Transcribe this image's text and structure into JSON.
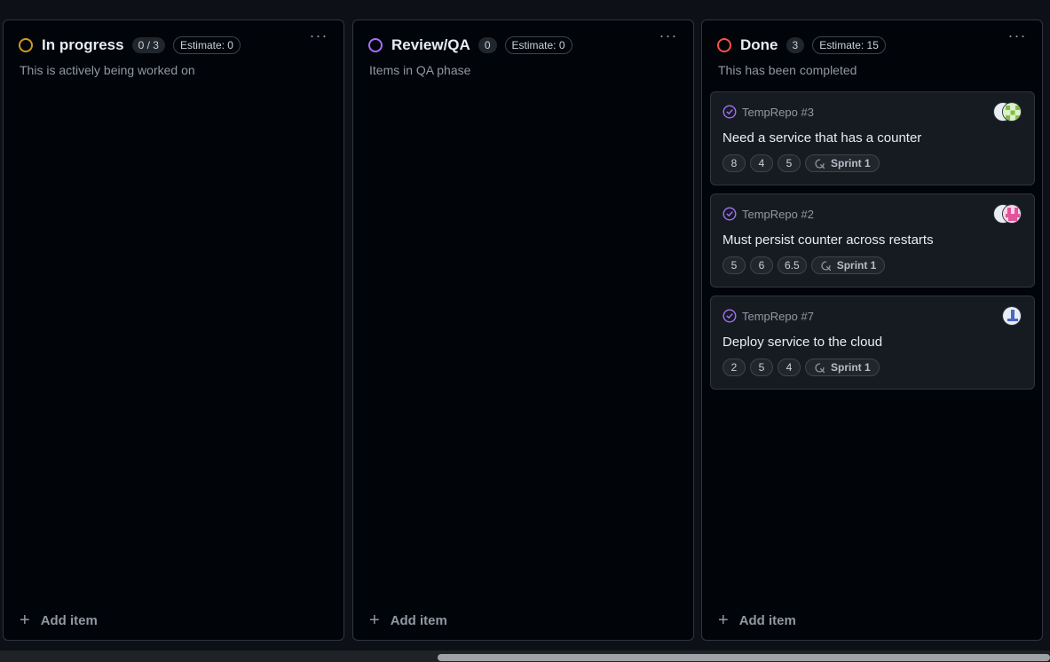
{
  "columns": [
    {
      "title": "In progress",
      "count": "0 / 3",
      "estimate": "Estimate: 0",
      "description": "This is actively being worked on",
      "status_color": "#d29922",
      "add_label": "Add item"
    },
    {
      "title": "Review/QA",
      "count": "0",
      "estimate": "Estimate: 0",
      "description": "Items in QA phase",
      "status_color": "#a371f7",
      "add_label": "Add item"
    },
    {
      "title": "Done",
      "count": "3",
      "estimate": "Estimate: 15",
      "description": "This has been completed",
      "status_color": "#f85149",
      "add_label": "Add item",
      "cards": [
        {
          "repo": "TempRepo #3",
          "title": "Need a service that has a counter",
          "fields": [
            "8",
            "4",
            "5"
          ],
          "sprint": "Sprint 1"
        },
        {
          "repo": "TempRepo #2",
          "title": "Must persist counter across restarts",
          "fields": [
            "5",
            "6",
            "6.5"
          ],
          "sprint": "Sprint 1"
        },
        {
          "repo": "TempRepo #7",
          "title": "Deploy service to the cloud",
          "fields": [
            "2",
            "5",
            "4"
          ],
          "sprint": "Sprint 1"
        }
      ]
    }
  ],
  "menu_icon": "more-horizontal-icon",
  "issue_icon": "issue-closed-icon",
  "iteration_icon": "iteration-icon",
  "plus_icon": "plus-icon"
}
